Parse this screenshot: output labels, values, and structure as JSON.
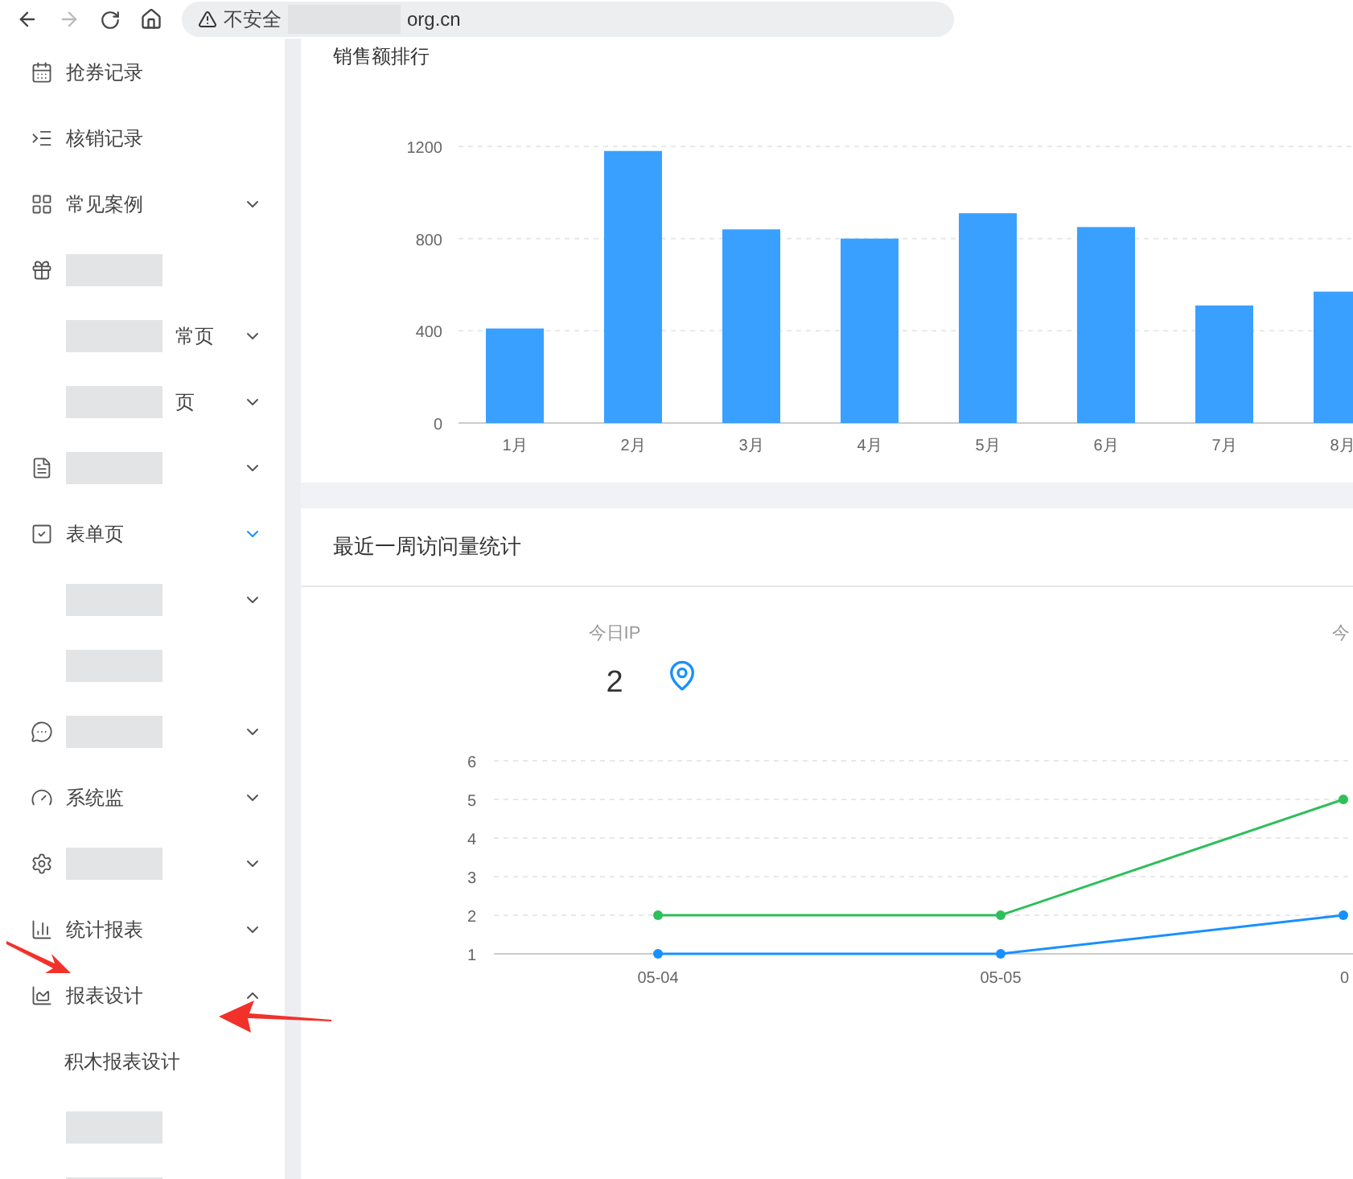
{
  "browser": {
    "security": "不安全",
    "address": "org.cn",
    "forward_disabled": true
  },
  "sidebar": {
    "items": [
      {
        "label": "抢券记录",
        "kind": "link"
      },
      {
        "label": "核销记录",
        "kind": "link"
      },
      {
        "label": "常见案例",
        "kind": "menu",
        "expanded": false,
        "active": false
      },
      {
        "kind": "redacted"
      },
      {
        "label": "常页",
        "kind": "menu",
        "expanded": false,
        "active": false,
        "redacted": true
      },
      {
        "label": "页",
        "kind": "menu",
        "expanded": false,
        "active": false,
        "redacted": true
      },
      {
        "kind": "menu",
        "expanded": false,
        "active": false,
        "redacted": true
      },
      {
        "label": "表单页",
        "kind": "menu",
        "expanded": false,
        "active": true
      },
      {
        "kind": "menu",
        "expanded": false,
        "active": false,
        "redacted": true
      },
      {
        "kind": "redacted"
      },
      {
        "kind": "menu",
        "expanded": false,
        "active": false,
        "redacted": true
      },
      {
        "label": "系统监",
        "kind": "menu",
        "expanded": false,
        "active": false
      },
      {
        "kind": "menu",
        "expanded": false,
        "active": false,
        "redacted": true
      },
      {
        "label": "统计报表",
        "kind": "menu",
        "expanded": false,
        "active": false
      },
      {
        "label": "报表设计",
        "kind": "menu",
        "expanded": true,
        "active": false,
        "children": [
          {
            "label": "积木报表设计"
          }
        ]
      },
      {
        "kind": "redacted"
      },
      {
        "kind": "redacted"
      }
    ]
  },
  "sales_card": {
    "title": "销售额排行",
    "chart_data": {
      "type": "bar",
      "categories": [
        "1月",
        "2月",
        "3月",
        "4月",
        "5月",
        "6月",
        "7月",
        "8月"
      ],
      "series": [
        {
          "color": "#3aa0ff",
          "values": [
            410,
            1180,
            840,
            800,
            910,
            850,
            510,
            570
          ]
        }
      ],
      "ylim": [
        0,
        1200
      ],
      "yticks": [
        0,
        400,
        800,
        1200
      ],
      "grid": true
    }
  },
  "visits_card": {
    "title": "最近一周访问量统计",
    "stats": [
      {
        "label": "今日IP",
        "value": "2"
      },
      {
        "label": "今"
      }
    ],
    "chart_data": {
      "type": "line",
      "categories": [
        "05-04",
        "05-05",
        "0"
      ],
      "series": [
        {
          "color": "#2dbf5a",
          "values": [
            2,
            2,
            5
          ],
          "marker": true
        },
        {
          "color": "#1890ff",
          "values": [
            1,
            1,
            2
          ],
          "marker": true
        }
      ],
      "ylim": [
        1,
        6
      ],
      "yticks": [
        1,
        2,
        3,
        4,
        5,
        6
      ],
      "grid": true
    }
  }
}
